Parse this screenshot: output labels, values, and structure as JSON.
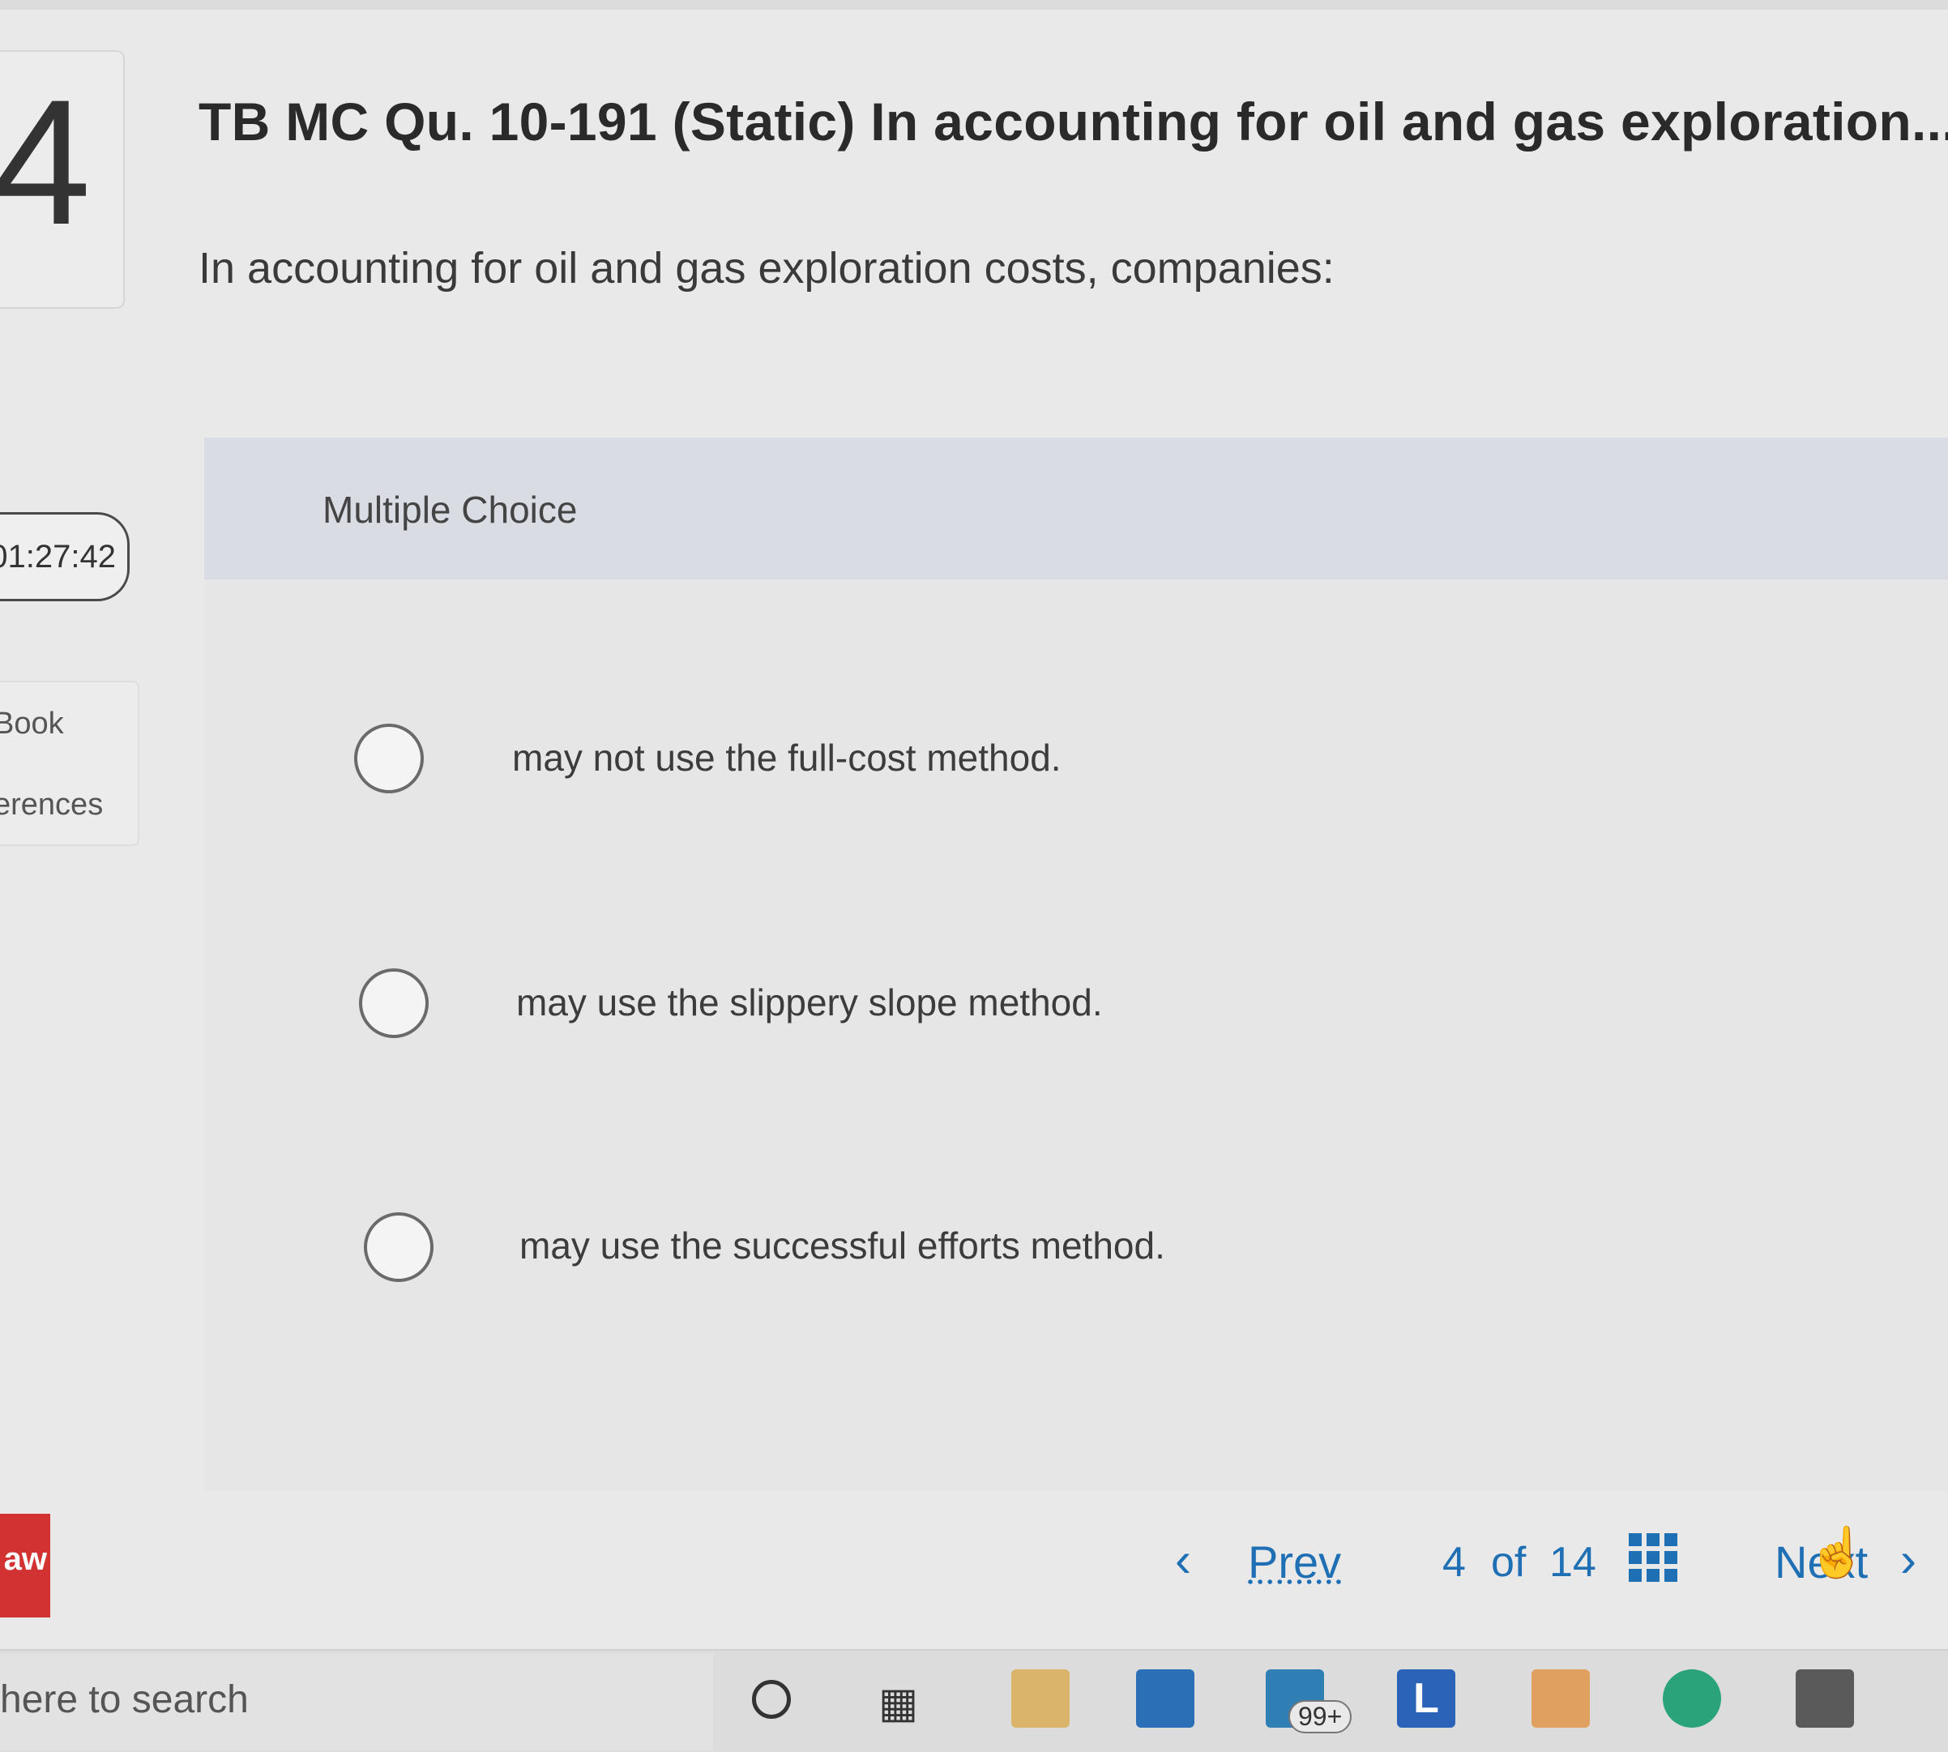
{
  "question": {
    "number": "4",
    "title": "TB MC Qu. 10-191 (Static) In accounting for oil and gas exploration...",
    "prompt": "In accounting for oil and gas exploration costs, companies:"
  },
  "timer": {
    "value": "01:27:42"
  },
  "sidebar": {
    "links": [
      {
        "label": "Book"
      },
      {
        "label": "erences"
      }
    ]
  },
  "answer_area": {
    "type_label": "Multiple Choice",
    "choices": [
      {
        "text": "may not use the full-cost method."
      },
      {
        "text": "may use the slippery slope method."
      },
      {
        "text": "may use the successful efforts method."
      }
    ]
  },
  "logo": {
    "text": "aw"
  },
  "navigation": {
    "prev_label": "Prev",
    "next_label": "Next",
    "current_page": "4",
    "of_label": "of",
    "total_pages": "14"
  },
  "taskbar": {
    "search_placeholder": "here to search",
    "notification_badge": "99+",
    "letter_icon": "L",
    "icons": [
      "cortana-icon",
      "task-view-icon",
      "file-explorer-icon",
      "store-icon",
      "mail-icon",
      "app-l-icon",
      "app-icon",
      "edge-icon",
      "calculator-icon"
    ]
  },
  "colors": {
    "accent": "#1f6fb5",
    "logo_red": "#d23232",
    "mc_header_bg": "#d9dde3"
  }
}
